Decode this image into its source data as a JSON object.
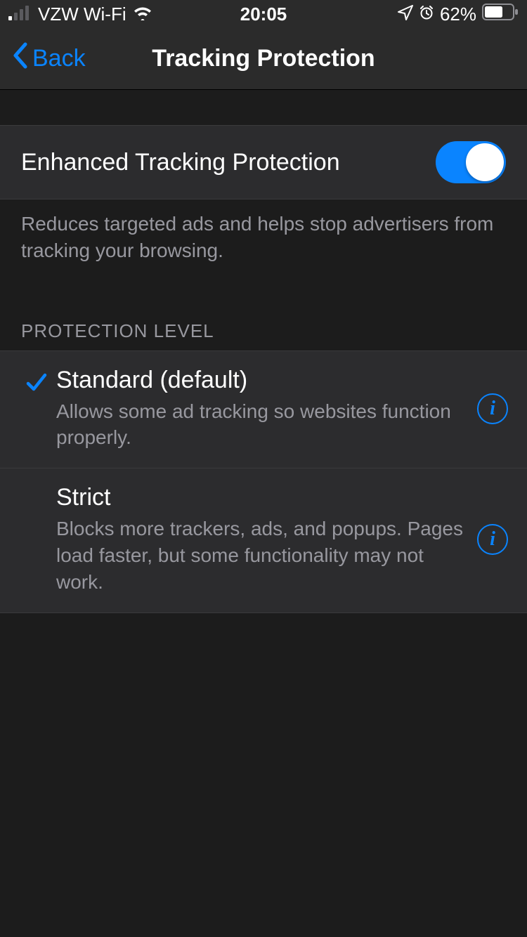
{
  "status": {
    "carrier": "VZW Wi-Fi",
    "time": "20:05",
    "battery_pct": "62%"
  },
  "nav": {
    "back_label": "Back",
    "title": "Tracking Protection"
  },
  "toggle": {
    "label": "Enhanced Tracking Protection",
    "description": "Reduces targeted ads and helps stop advertisers from tracking your browsing.",
    "on": true
  },
  "section": {
    "header": "PROTECTION LEVEL"
  },
  "options": [
    {
      "title": "Standard (default)",
      "desc": "Allows some ad tracking so websites function properly.",
      "selected": true
    },
    {
      "title": "Strict",
      "desc": "Blocks more trackers, ads, and popups. Pages load faster, but some functionality may not work.",
      "selected": false
    }
  ],
  "colors": {
    "accent": "#0a84ff",
    "row_bg": "#2c2c2e",
    "page_bg": "#1c1c1c",
    "muted_text": "#98989f"
  }
}
